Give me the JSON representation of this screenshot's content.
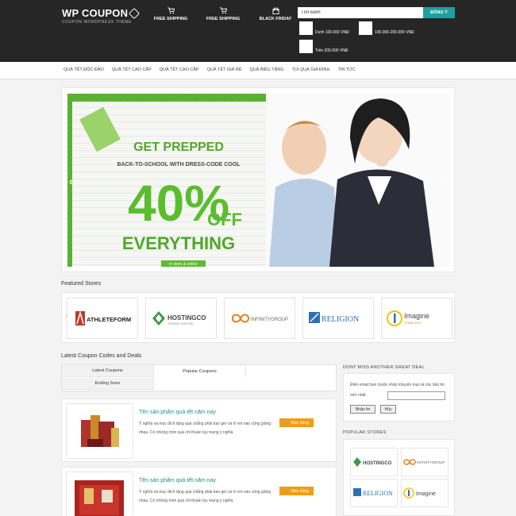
{
  "header": {
    "logo_title": "WP COUPON",
    "logo_subtitle": "COUPON WORDPRESS THEME",
    "nav": [
      {
        "label": "FREE SHIPPING",
        "icon": "cart-icon"
      },
      {
        "label": "FREE SHIPPING",
        "icon": "cart-icon"
      },
      {
        "label": "BLACK FRIDAY",
        "icon": "gift-icon"
      }
    ],
    "search": {
      "value": "Tìm kiếm",
      "button": "ĐỒNG Ý"
    },
    "price_filters": [
      "Dưới 100.000 VNĐ",
      "100.000-200.000 VNĐ",
      "Trên 200.000 VNĐ"
    ]
  },
  "categories": [
    "QUÀ TẾT ĐỘC ĐÁO",
    "QUÀ TẾT CAO CẤP",
    "QUÀ TẾT CAO CẤP",
    "QUÀ TẾT GIÁ RẺ",
    "QUÀ BIẾU TẶNG",
    "TÚI QUÀ GIA ĐÌNH",
    "TIN TỨC"
  ],
  "banner": {
    "headline": "GET PREPPED",
    "subline": "BACK-TO-SCHOOL WITH DRESS-CODE COOL",
    "percent": "40%",
    "off": "OFF",
    "everything": "EVERYTHING",
    "footer": "in store & online"
  },
  "featured": {
    "title": "Featured Stores",
    "stores": [
      "ATHLETEFORM",
      "HOSTINGCO",
      "INFINITYGROUP",
      "RELIGION",
      "Imagine"
    ],
    "store_taglines": [
      "",
      "GENERIC HOSTING",
      "",
      "",
      "STARLIGHT"
    ]
  },
  "latest": {
    "title": "Latest Coupon Codes and Deals",
    "tabs": [
      "Latest Coupons",
      "Popular Coupons",
      "Ending Soon"
    ]
  },
  "products": [
    {
      "title": "Tên sản phẩm quà tết năm nay",
      "desc": "Ý nghĩa và mục đích tặng quà chẳng phải bao giờ và ở nơi nào cũng giống nhau. Có những món quà chỉ thuần túy mang ý nghĩa",
      "button": "Mua hàng"
    },
    {
      "title": "Tên sản phẩm quà tết năm nay",
      "desc": "Ý nghĩa và mục đích tặng quà chẳng phải bao giờ và ở nơi nào cũng giống nhau. Có những món quà chỉ thuần túy mang ý nghĩa",
      "button": "Mua hàng"
    }
  ],
  "sidebar": {
    "newsletter_title": "DONT MISS ANOTHER GREAT DEAL",
    "newsletter_text": "Điền email bạn muốn nhận khuyến mại và các bản tin mới nhất",
    "subscribe": "Nhận tin",
    "cancel": "Hủy",
    "popular_title": "POPULAR STORES",
    "popular_stores": [
      "HOSTINGCO",
      "INFINITYGROUP",
      "RELIGION",
      "Imagine"
    ]
  },
  "colors": {
    "header": "#262626",
    "accent": "#1fa0a0",
    "buy": "#f39c12",
    "title": "#1a8e8e",
    "banner_green": "#5bbd2e"
  }
}
